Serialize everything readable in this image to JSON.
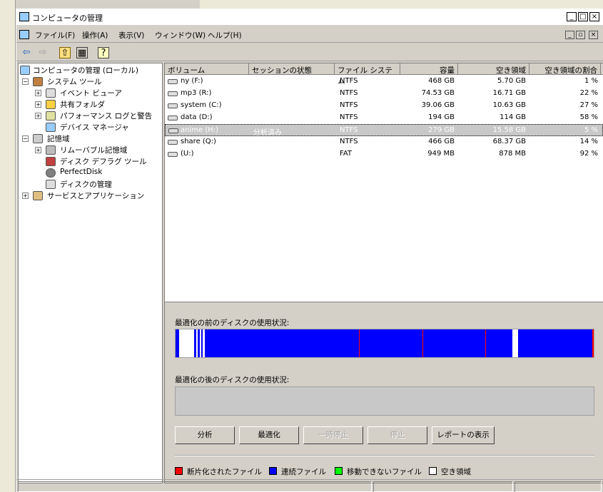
{
  "window": {
    "title": "コンピュータの管理",
    "controls": {
      "minimize": "_",
      "maximize": "□",
      "close": "×"
    }
  },
  "menubar": {
    "items": [
      "ファイル(F)",
      "操作(A)",
      "表示(V)",
      "ウィンドウ(W)",
      "ヘルプ(H)"
    ],
    "mdi_controls": {
      "minimize": "_",
      "restore": "▫",
      "close": "×"
    }
  },
  "toolbar": {
    "back": "⇦",
    "forward": "⇨",
    "up": "⇧",
    "show_tree": "▦",
    "help": "?"
  },
  "tree": {
    "root": "コンピュータの管理 (ローカル)",
    "system_tools": "システム ツール",
    "event_viewer": "イベント ビューア",
    "shared_folders": "共有フォルダ",
    "perf_logs": "パフォーマンス ログと警告",
    "device_manager": "デバイス マネージャ",
    "storage": "記憶域",
    "removable_storage": "リムーバブル記憶域",
    "disk_defrag": "ディスク デフラグ ツール",
    "perfectdisk": "PerfectDisk",
    "disk_management": "ディスクの管理",
    "services_apps": "サービスとアプリケーション",
    "expand_plus": "+",
    "expand_minus": "−"
  },
  "volumes": {
    "columns": [
      "ボリューム",
      "セッションの状態",
      "ファイル システム",
      "容量",
      "空き領域",
      "空き領域の割合"
    ],
    "rows": [
      {
        "name": "ny (F:)",
        "session": "",
        "fs": "NTFS",
        "capacity": "468 GB",
        "free": "5.70 GB",
        "pct": "1 %"
      },
      {
        "name": "mp3 (R:)",
        "session": "",
        "fs": "NTFS",
        "capacity": "74.53 GB",
        "free": "16.71 GB",
        "pct": "22 %"
      },
      {
        "name": "system (C:)",
        "session": "",
        "fs": "NTFS",
        "capacity": "39.06 GB",
        "free": "10.63 GB",
        "pct": "27 %"
      },
      {
        "name": "data (D:)",
        "session": "",
        "fs": "NTFS",
        "capacity": "194 GB",
        "free": "114 GB",
        "pct": "58 %"
      },
      {
        "name": "anime (H:)",
        "session": "分析済み",
        "fs": "NTFS",
        "capacity": "279 GB",
        "free": "15.58 GB",
        "pct": "5 %"
      },
      {
        "name": "share (Q:)",
        "session": "",
        "fs": "NTFS",
        "capacity": "466 GB",
        "free": "68.37 GB",
        "pct": "14 %"
      },
      {
        "name": "(U:)",
        "session": "",
        "fs": "FAT",
        "capacity": "949 MB",
        "free": "878 MB",
        "pct": "92 %"
      }
    ],
    "selected_index": 4
  },
  "defrag": {
    "before_label": "最適化の前のディスクの使用状況:",
    "after_label": "最適化の後のディスクの使用状況:",
    "buttons": {
      "analyze": "分析",
      "defragment": "最適化",
      "pause": "一時停止",
      "stop": "停止",
      "report": "レポートの表示"
    },
    "legend": {
      "fragmented": "断片化されたファイル",
      "contiguous": "連続ファイル",
      "unmovable": "移動できないファイル",
      "free": "空き領域"
    },
    "colors": {
      "fragmented": "#ff0000",
      "contiguous": "#0000ff",
      "unmovable": "#00ff00",
      "free": "#ffffff"
    }
  }
}
